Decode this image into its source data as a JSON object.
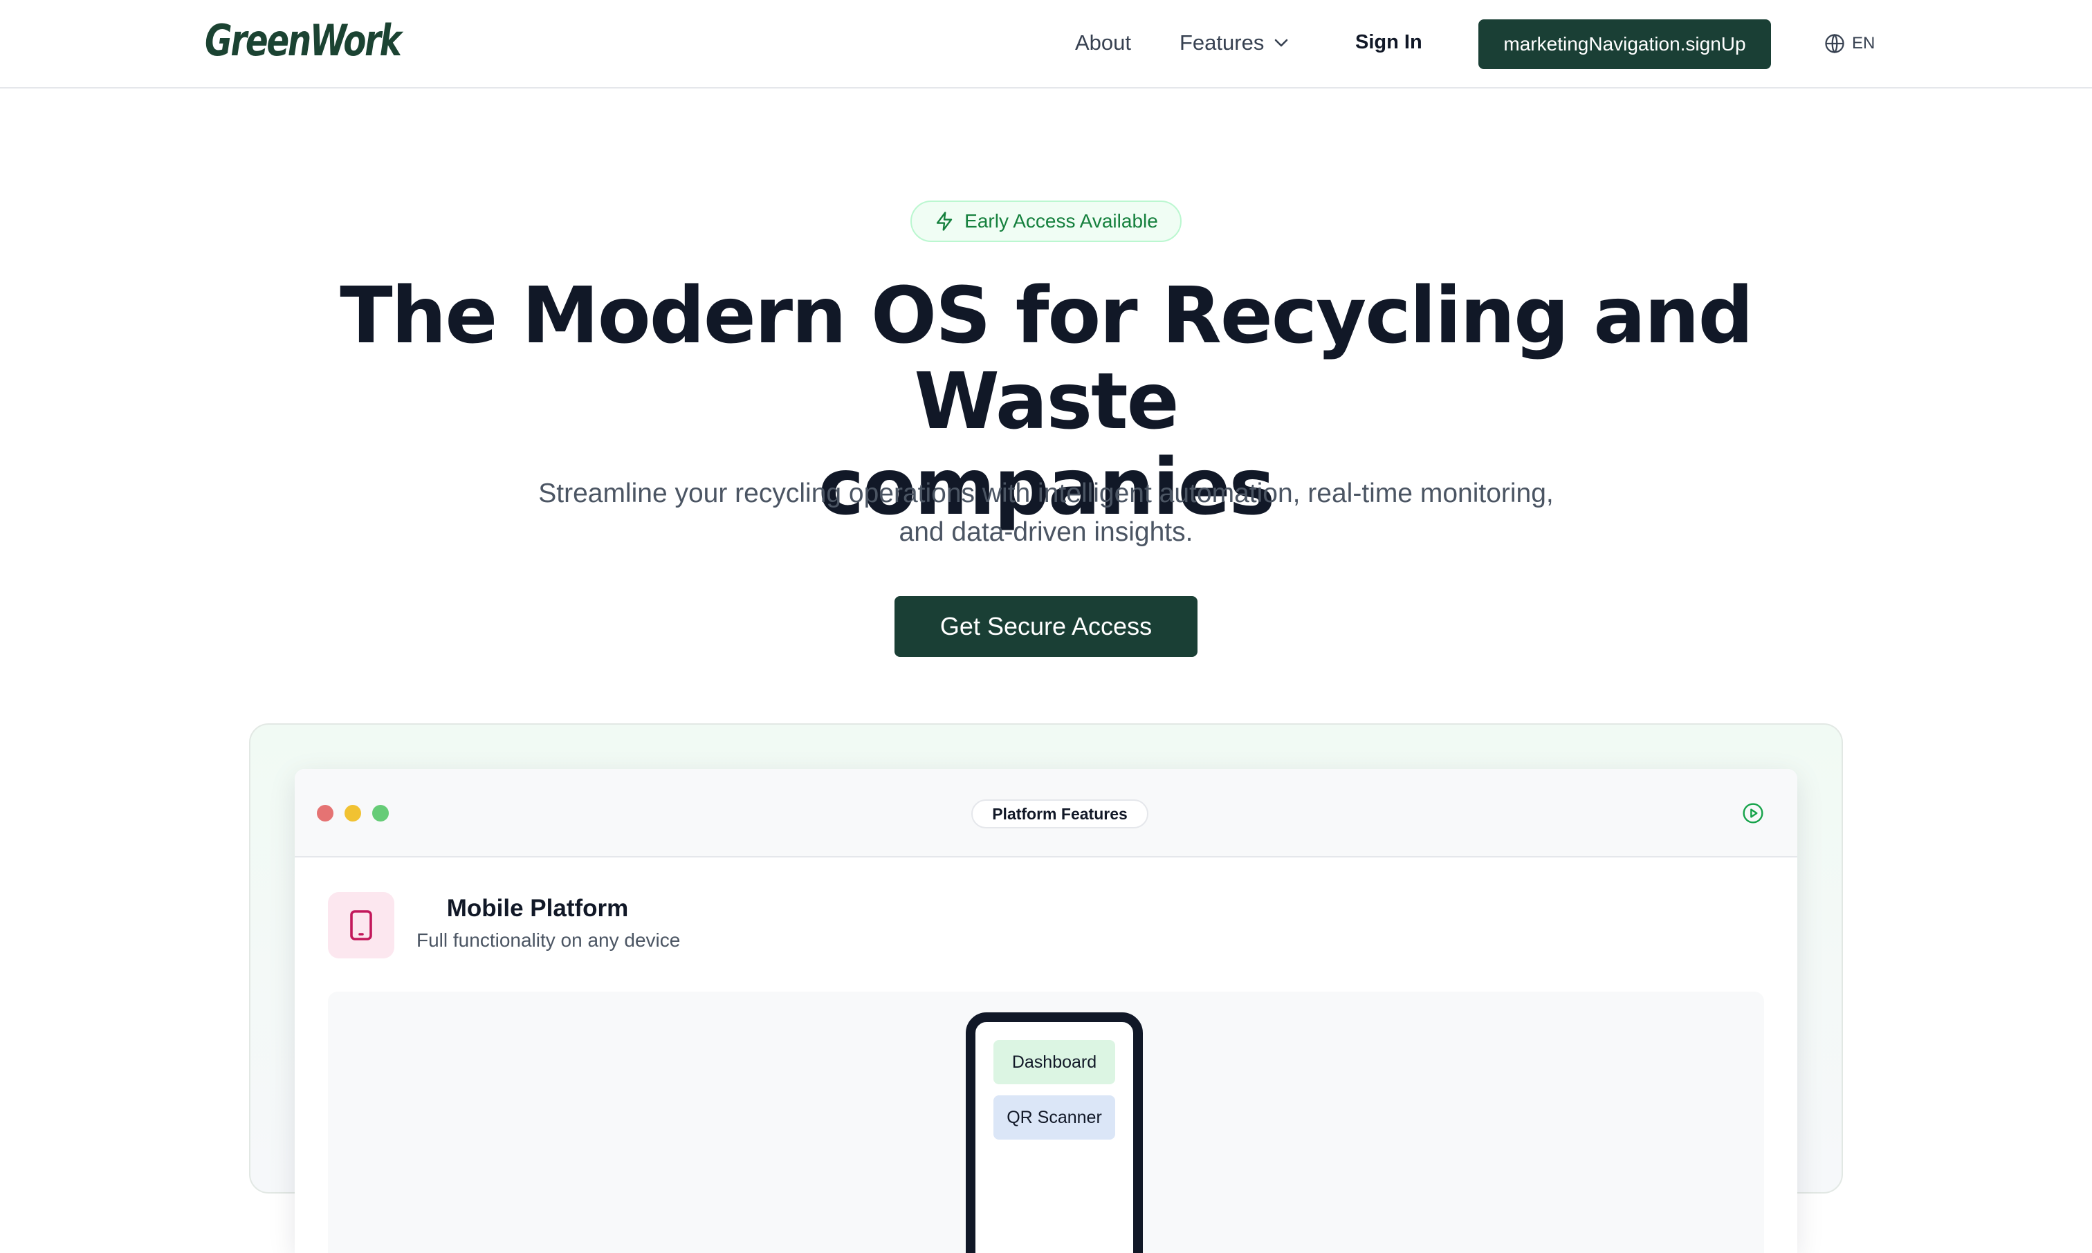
{
  "header": {
    "logo": "GreenWork",
    "nav": {
      "about": "About",
      "features": "Features",
      "sign_in": "Sign In",
      "sign_up": "marketingNavigation.signUp",
      "language": "EN"
    }
  },
  "hero": {
    "badge": "Early Access Available",
    "title_line1": "The Modern OS for Recycling and Waste",
    "title_line2": "companies",
    "subtitle_line1": "Streamline your recycling operations with intelligent automation, real-time monitoring,",
    "subtitle_line2": "and data-driven insights.",
    "cta": "Get Secure Access"
  },
  "showcase": {
    "window_title": "Platform Features",
    "feature": {
      "title": "Mobile Platform",
      "description": "Full functionality on any device",
      "icon": "tablet-icon"
    },
    "phone_menu": [
      "Dashboard",
      "QR Scanner"
    ]
  },
  "colors": {
    "brand_dark_green": "#1a3f35",
    "accent_green": "#15803d",
    "badge_bg": "#f0fdf4",
    "feature_icon_bg": "#fce7ef",
    "feature_icon_fg": "#c2185b",
    "window_dot_red": "#e57373",
    "window_dot_yellow": "#f1c232",
    "window_dot_green": "#66cc77"
  }
}
